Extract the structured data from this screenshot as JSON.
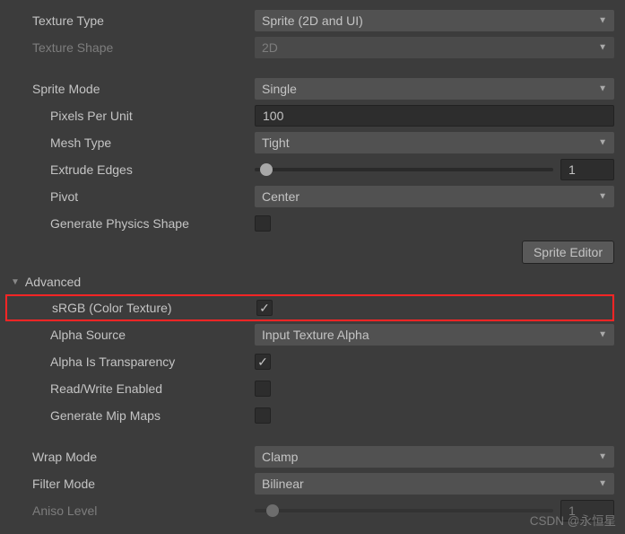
{
  "textureType": {
    "label": "Texture Type",
    "value": "Sprite (2D and UI)"
  },
  "textureShape": {
    "label": "Texture Shape",
    "value": "2D"
  },
  "spriteMode": {
    "label": "Sprite Mode",
    "value": "Single"
  },
  "pixelsPerUnit": {
    "label": "Pixels Per Unit",
    "value": "100"
  },
  "meshType": {
    "label": "Mesh Type",
    "value": "Tight"
  },
  "extrudeEdges": {
    "label": "Extrude Edges",
    "value": "1"
  },
  "pivot": {
    "label": "Pivot",
    "value": "Center"
  },
  "generatePhysicsShape": {
    "label": "Generate Physics Shape"
  },
  "spriteEditorBtn": "Sprite Editor",
  "advanced": {
    "label": "Advanced"
  },
  "srgb": {
    "label": "sRGB (Color Texture)"
  },
  "alphaSource": {
    "label": "Alpha Source",
    "value": "Input Texture Alpha"
  },
  "alphaIsTransparency": {
    "label": "Alpha Is Transparency"
  },
  "readWriteEnabled": {
    "label": "Read/Write Enabled"
  },
  "generateMipMaps": {
    "label": "Generate Mip Maps"
  },
  "wrapMode": {
    "label": "Wrap Mode",
    "value": "Clamp"
  },
  "filterMode": {
    "label": "Filter Mode",
    "value": "Bilinear"
  },
  "anisoLevel": {
    "label": "Aniso Level",
    "value": "1"
  },
  "watermark": "CSDN @永恒星"
}
